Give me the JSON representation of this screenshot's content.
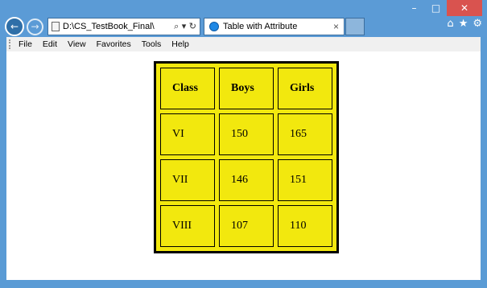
{
  "browser": {
    "address": "D:\\CS_TestBook_Final\\",
    "tab_title": "Table with Attribute",
    "caption": {
      "minimize": "–",
      "maximize": "□",
      "close": "✕"
    },
    "nav": {
      "back": "←",
      "forward": "→",
      "search_tools": "⌕ ▾ ↻",
      "tab_close": "×"
    },
    "toolbar_icons": {
      "home": "⌂",
      "favorites": "★",
      "settings": "⚙"
    }
  },
  "menu": {
    "items": [
      {
        "label": "File"
      },
      {
        "label": "Edit"
      },
      {
        "label": "View"
      },
      {
        "label": "Favorites"
      },
      {
        "label": "Tools"
      },
      {
        "label": "Help"
      }
    ]
  },
  "table": {
    "headers": [
      "Class",
      "Boys",
      "Girls"
    ],
    "rows": [
      [
        "VI",
        "150",
        "165"
      ],
      [
        "VII",
        "146",
        "151"
      ],
      [
        "VIII",
        "107",
        "110"
      ]
    ],
    "background_color": "#f2e80e"
  }
}
